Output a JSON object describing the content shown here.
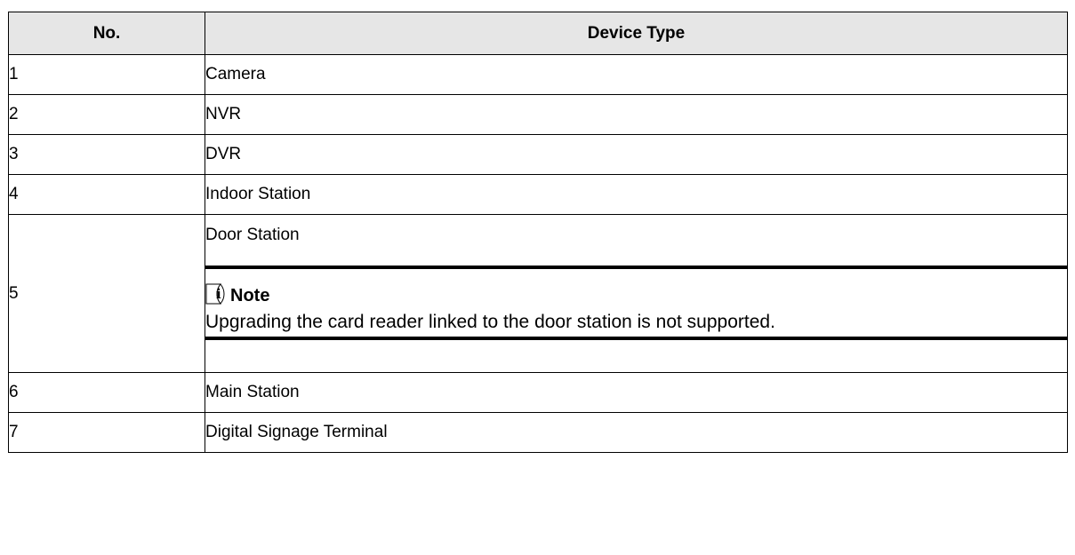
{
  "table": {
    "headers": {
      "no": "No.",
      "device_type": "Device Type"
    },
    "rows": [
      {
        "no": "1",
        "type": "Camera"
      },
      {
        "no": "2",
        "type": "NVR"
      },
      {
        "no": "3",
        "type": "DVR"
      },
      {
        "no": "4",
        "type": "Indoor Station"
      },
      {
        "no": "5",
        "type": "Door Station",
        "note": {
          "icon": "note-info-icon",
          "label": "Note",
          "text": "Upgrading the card reader linked to the door station is not supported."
        }
      },
      {
        "no": "6",
        "type": "Main Station"
      },
      {
        "no": "7",
        "type": "Digital Signage Terminal"
      }
    ]
  }
}
